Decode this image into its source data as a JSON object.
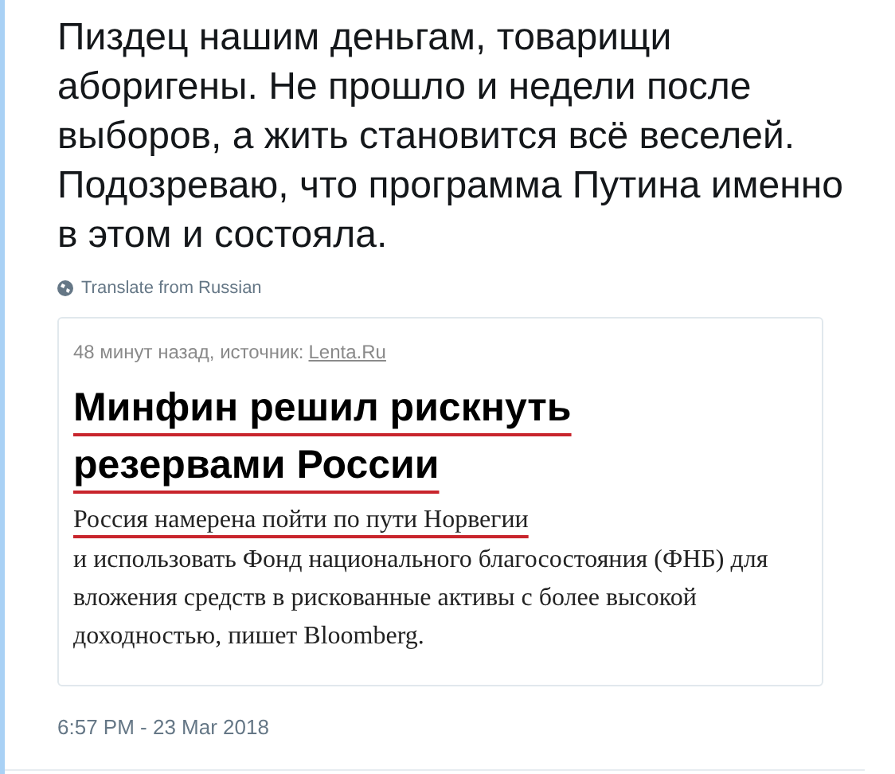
{
  "tweet": {
    "text": "Пиздец нашим деньгам, товарищи аборигены. Не прошло и недели после выборов, а жить становится всё веселей. Подозреваю, что программа Путина именно в этом и состояла.",
    "translate_link": "Translate from Russian",
    "embedded_image": {
      "meta": "48 минут назад, источник:",
      "source_link": "Lenta.Ru",
      "headline": "Минфин решил рискнуть резервами России",
      "lead": "Россия намерена пойти по пути Норвегии",
      "body": "и использовать Фонд национального благосостояния (ФНБ) для вложения средств в рискованные активы с более высокой доходностью, пишет Bloomberg."
    },
    "timestamp": "6:57 PM - 23 Mar 2018"
  }
}
